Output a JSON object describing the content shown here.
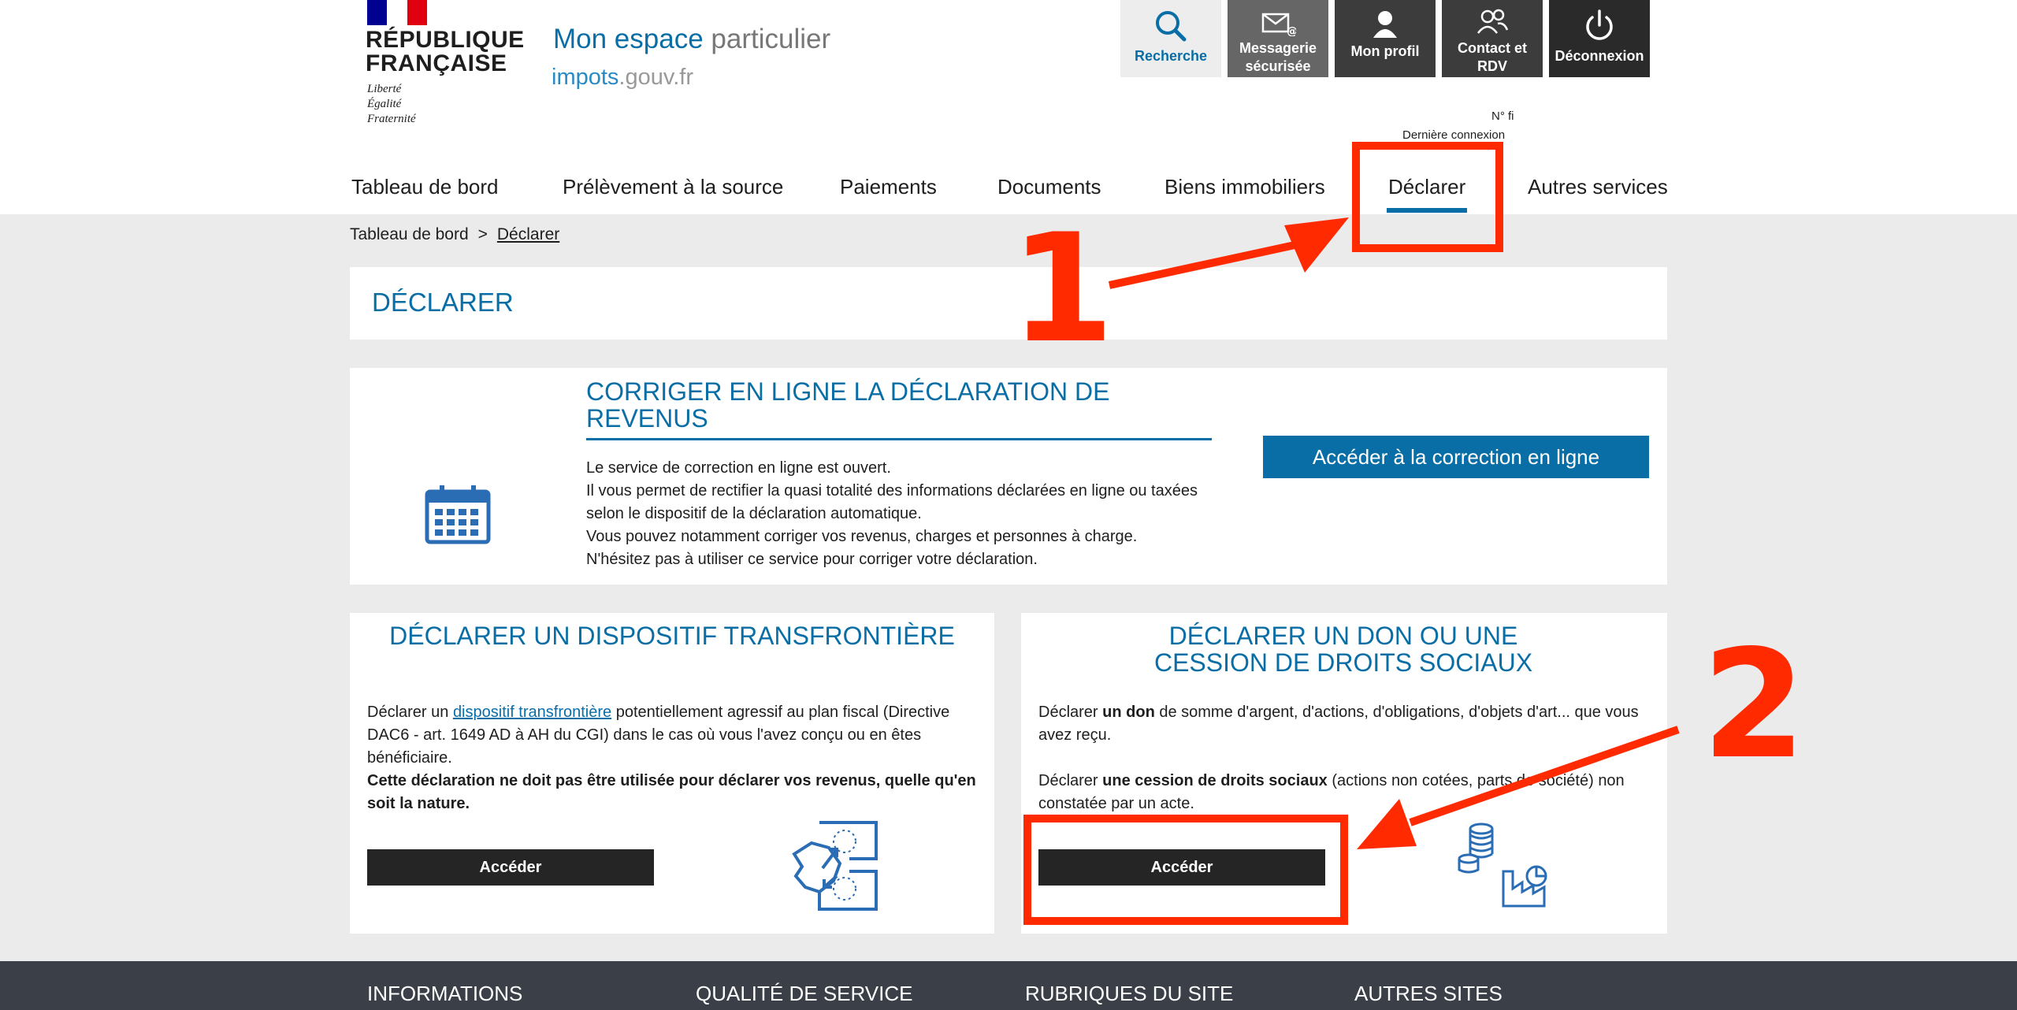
{
  "logo": {
    "line1": "RÉPUBLIQUE",
    "line2": "FRANÇAISE",
    "motto": [
      "Liberté",
      "Égalité",
      "Fraternité"
    ]
  },
  "site": {
    "title_a": "Mon espace",
    "title_b": " particulier",
    "sub_a": "impots",
    "sub_b": ".gouv.fr"
  },
  "top_buttons": [
    {
      "label": "Recherche",
      "icon": "search-icon"
    },
    {
      "label": "Messagerie sécurisée",
      "icon": "envelope-at-icon"
    },
    {
      "label": "Mon profil",
      "icon": "user-icon"
    },
    {
      "label": "Contact et RDV",
      "icon": "users-icon"
    },
    {
      "label": "Déconnexion",
      "icon": "power-icon"
    }
  ],
  "connection": {
    "fiscal_no": "N° fi",
    "last_connection": "Dernière connexion"
  },
  "nav": [
    "Tableau de bord",
    "Prélèvement à la source",
    "Paiements",
    "Documents",
    "Biens immobiliers",
    "Déclarer",
    "Autres services"
  ],
  "breadcrumb": {
    "home": "Tableau de bord",
    "sep": ">",
    "current": "Déclarer"
  },
  "page_title": "DÉCLARER",
  "correction": {
    "title": "CORRIGER EN LIGNE LA DÉCLARATION DE REVENUS",
    "lines": [
      "Le service de correction en ligne est ouvert.",
      "Il vous permet de rectifier la quasi totalité des informations déclarées en ligne ou taxées selon le dispositif de la déclaration automatique.",
      "Vous pouvez notamment corriger vos revenus, charges et personnes à charge.",
      "N'hésitez pas à utiliser ce service pour corriger votre déclaration."
    ],
    "button": "Accéder à la correction en ligne"
  },
  "transfrontiere": {
    "title": "DÉCLARER UN DISPOSITIF TRANSFRONTIÈRE",
    "text_a": "Déclarer un ",
    "link": "dispositif transfrontière",
    "text_b": " potentiellement agressif au plan fiscal (Directive DAC6 - art. 1649 AD à AH du CGI) dans le cas où vous l'avez conçu ou en êtes bénéficiaire.",
    "bold": "Cette déclaration ne doit pas être utilisée pour déclarer vos revenus, quelle qu'en soit la nature.",
    "button": "Accéder"
  },
  "don": {
    "title_1": "DÉCLARER UN DON OU UNE",
    "title_2": "CESSION DE DROITS SOCIAUX",
    "p1_a": "Déclarer ",
    "p1_b": "un don",
    "p1_c": " de somme d'argent, d'actions, d'obligations, d'objets d'art... que vous avez reçu.",
    "p2_a": "Déclarer ",
    "p2_b": "une cession de droits sociaux",
    "p2_c": " (actions non cotées, parts de société) non constatée par un acte.",
    "button": "Accéder"
  },
  "footer": [
    "INFORMATIONS",
    "QUALITÉ DE SERVICE",
    "RUBRIQUES DU SITE",
    "AUTRES SITES"
  ],
  "annotations": {
    "step1": "1",
    "step2": "2",
    "color": "#ff2a00"
  },
  "colors": {
    "brand_blue": "#0a6ea6",
    "dark_button": "#252525",
    "footer": "#3b3f48"
  }
}
